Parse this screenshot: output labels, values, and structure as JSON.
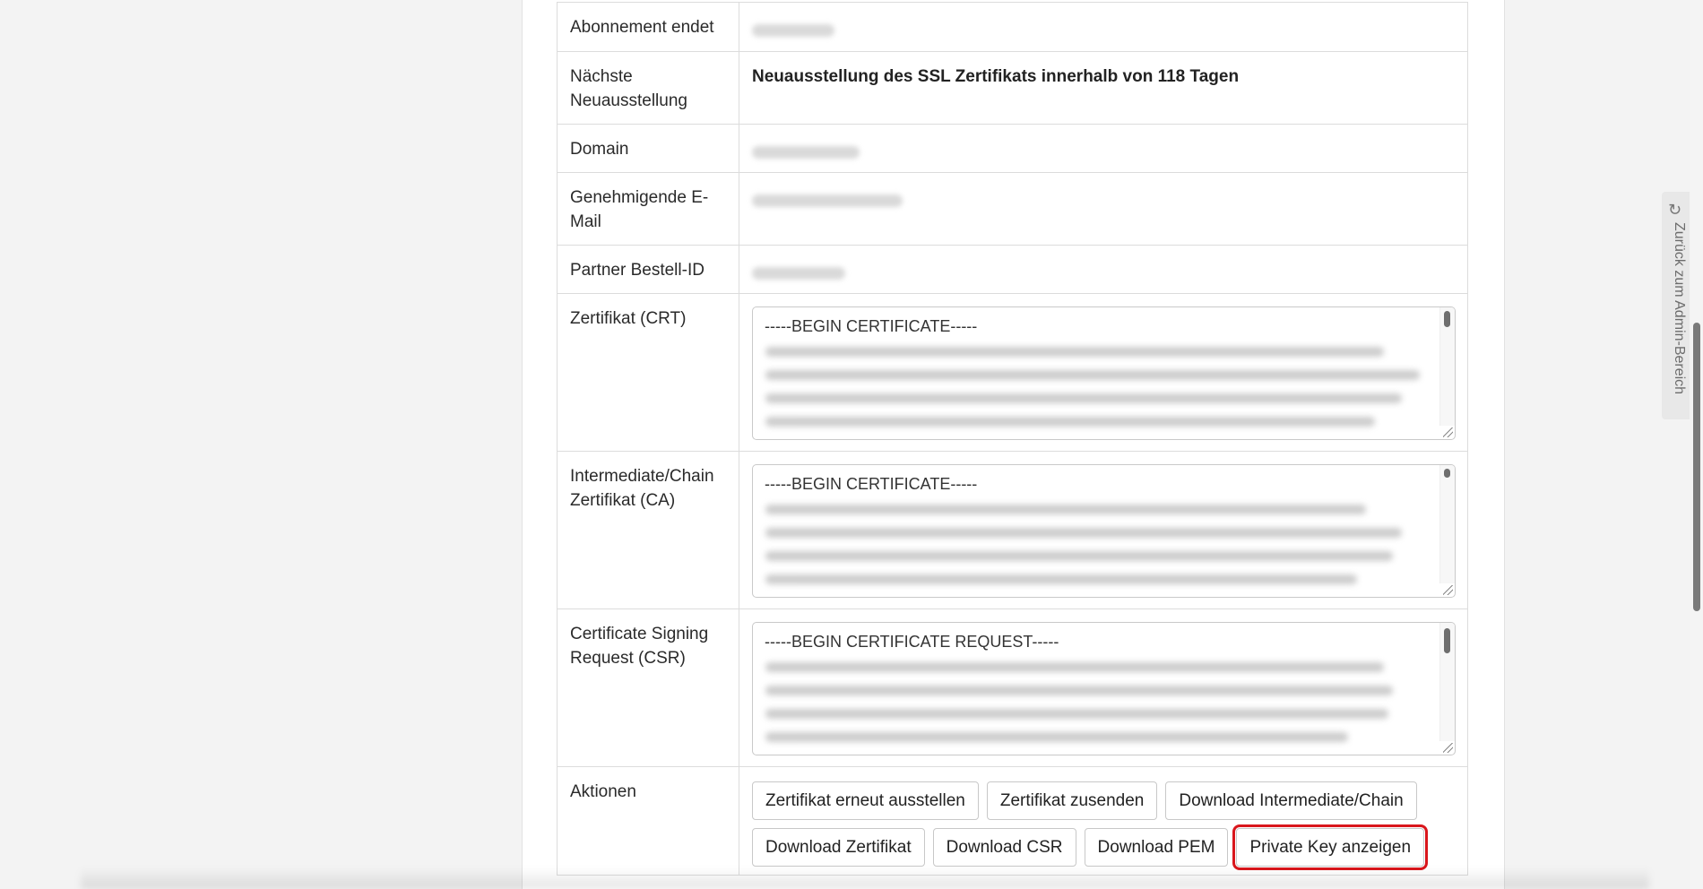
{
  "rows": {
    "abonnement": {
      "label": "Abonnement endet"
    },
    "next_reissue": {
      "label": "Nächste Neuausstellung",
      "value": "Neuausstellung des SSL Zertifikats innerhalb von 118 Tagen"
    },
    "domain": {
      "label": "Domain"
    },
    "approver_email": {
      "label": "Genehmigende E-Mail"
    },
    "partner_order_id": {
      "label": "Partner Bestell-ID"
    },
    "crt": {
      "label": "Zertifikat (CRT)",
      "header_line": "-----BEGIN CERTIFICATE-----"
    },
    "ca": {
      "label": "Intermediate/Chain Zertifikat (CA)",
      "header_line": "-----BEGIN CERTIFICATE-----"
    },
    "csr": {
      "label": "Certificate Signing Request (CSR)",
      "header_line": "-----BEGIN CERTIFICATE REQUEST-----"
    },
    "actions": {
      "label": "Aktionen",
      "buttons": {
        "reissue": "Zertifikat erneut ausstellen",
        "send": "Zertifikat zusenden",
        "download_chain": "Download Intermediate/Chain",
        "download_cert": "Download Zertifikat",
        "download_csr": "Download CSR",
        "download_pem": "Download PEM",
        "show_private_key": "Private Key anzeigen"
      },
      "highlight_color": "#d9161c"
    }
  },
  "side_tab": {
    "label": "Zurück zum Admin-Bereich",
    "icon": "refresh-icon"
  }
}
